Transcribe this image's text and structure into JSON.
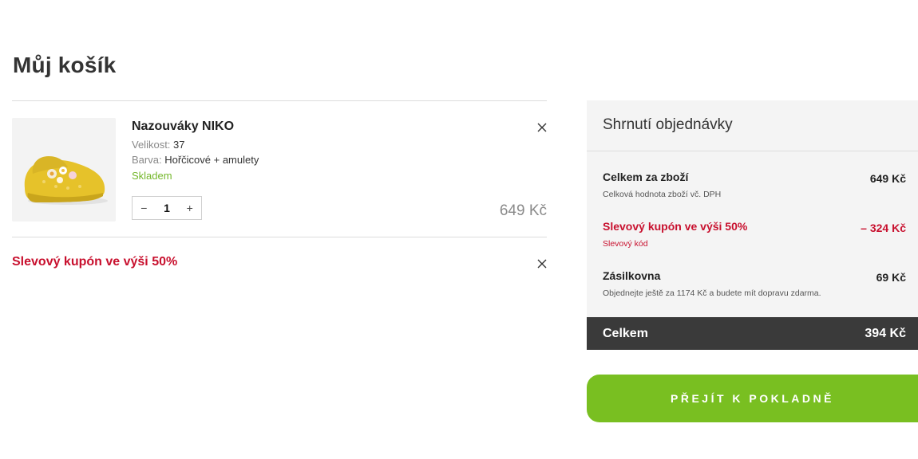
{
  "page": {
    "title": "Můj košík"
  },
  "cart": {
    "item": {
      "name": "Nazouváky NIKO",
      "size_label": "Velikost:",
      "size_value": "37",
      "color_label": "Barva:",
      "color_value": "Hořčicové + amulety",
      "stock": "Skladem",
      "quantity": "1",
      "qty_minus": "−",
      "qty_plus": "+",
      "price": "649 Kč",
      "image_icon": "yellow-clog-product-image"
    },
    "coupon": {
      "label": "Slevový kupón ve výši 50%"
    },
    "remove_icon": "close-icon"
  },
  "summary": {
    "title": "Shrnutí objednávky",
    "goods": {
      "title": "Celkem za zboží",
      "subtitle": "Celková hodnota zboží vč. DPH",
      "value": "649 Kč"
    },
    "discount": {
      "title": "Slevový kupón ve výši 50%",
      "subtitle": "Slevový kód",
      "value": "– 324 Kč"
    },
    "shipping": {
      "title": "Zásilkovna",
      "subtitle": "Objednejte ještě za 1174 Kč a budete mít dopravu zdarma.",
      "value": "69 Kč"
    },
    "total": {
      "label": "Celkem",
      "value": "394 Kč"
    }
  },
  "checkout": {
    "label": "PŘEJÍT K POKLADNĚ"
  },
  "colors": {
    "accent_green": "#79bf21",
    "discount_red": "#c8102e",
    "total_bar": "#3a3a3a",
    "stock_green": "#74b72b"
  }
}
